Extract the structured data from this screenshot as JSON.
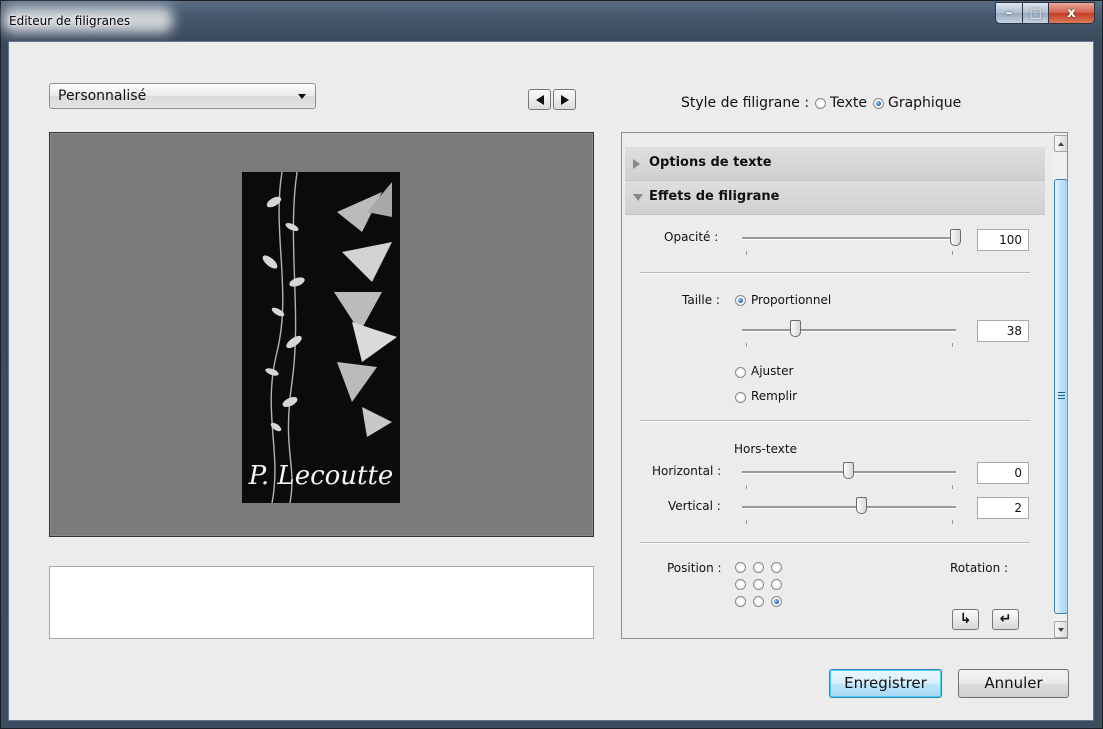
{
  "window": {
    "title": "Editeur de filigranes",
    "controls": {
      "minimize": "–",
      "maximize": "□",
      "close": "x"
    }
  },
  "preset": {
    "value": "Personnalisé"
  },
  "watermark_style": {
    "label": "Style de filigrane :",
    "options": [
      {
        "label": "Texte",
        "selected": false
      },
      {
        "label": "Graphique",
        "selected": true
      }
    ]
  },
  "preview": {
    "watermark_text": "P. Lecoutte"
  },
  "panel": {
    "sections": [
      {
        "label": "Options de texte",
        "expanded": false
      },
      {
        "label": "Effets de filigrane",
        "expanded": true
      }
    ],
    "opacity": {
      "label": "Opacité :",
      "value": "100",
      "level": 1.0
    },
    "size": {
      "label": "Taille :",
      "options": [
        {
          "label": "Proportionnel",
          "selected": true
        },
        {
          "label": "Ajuster",
          "selected": false
        },
        {
          "label": "Remplir",
          "selected": false
        }
      ],
      "value": "38",
      "level": 0.25
    },
    "inset": {
      "label": "Hors-texte",
      "horizontal": {
        "label": "Horizontal :",
        "value": "0",
        "level": 0.5
      },
      "vertical": {
        "label": "Vertical :",
        "value": "2",
        "level": 0.56
      }
    },
    "position": {
      "label": "Position :",
      "selected_index": 8
    },
    "rotation": {
      "label": "Rotation :",
      "cw": "↳",
      "ccw": "↵"
    }
  },
  "buttons": {
    "save": "Enregistrer",
    "cancel": "Annuler"
  },
  "colors": {
    "accent": "#3c7fb1",
    "preview_bg": "#7b7b7b"
  }
}
